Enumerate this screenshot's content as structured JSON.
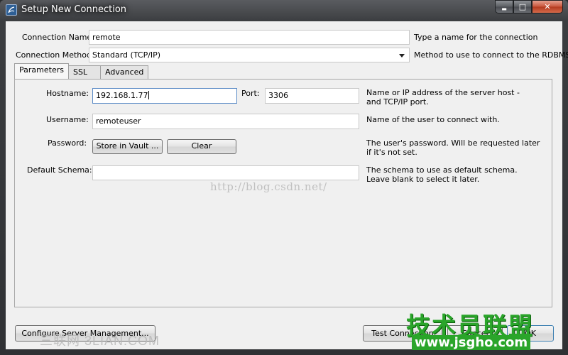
{
  "window": {
    "title": "Setup New Connection",
    "min_glyph": "▬",
    "max_glyph": "□",
    "close_glyph": "✕"
  },
  "connection_name": {
    "label": "Connection Name:",
    "value": "remote",
    "hint": "Type a name for the connection"
  },
  "connection_method": {
    "label": "Connection Method:",
    "value": "Standard (TCP/IP)",
    "hint": "Method to use to connect to the RDBMS"
  },
  "tabs": [
    {
      "label": "Parameters",
      "active": true
    },
    {
      "label": "SSL",
      "active": false
    },
    {
      "label": "Advanced",
      "active": false
    }
  ],
  "parameters": {
    "hostname": {
      "label": "Hostname:",
      "value": "192.168.1.77"
    },
    "port": {
      "label": "Port:",
      "value": "3306"
    },
    "hostname_hint": "Name or IP address of the server host - and TCP/IP port.",
    "username": {
      "label": "Username:",
      "value": "remoteuser",
      "hint": "Name of the user to connect with."
    },
    "password": {
      "label": "Password:",
      "store_button": "Store in Vault ...",
      "clear_button": "Clear",
      "hint": "The user's password. Will be requested later if it's not set."
    },
    "default_schema": {
      "label": "Default Schema:",
      "value": "",
      "hint": "The schema to use as default schema. Leave blank to select it later."
    }
  },
  "footer": {
    "configure_button": "Configure Server Management...",
    "test_button": "Test Connection",
    "cancel_button": "Cancel",
    "ok_button": "OK"
  },
  "watermarks": {
    "center_url": "http://blog.csdn.net/",
    "bottom_left": "三联网 3LIAN.COM",
    "logo_text": "技术员联盟",
    "logo_url": "www.jsgho.com"
  },
  "colors": {
    "logo_green": "#2aa52a",
    "focus_blue": "#5b8bc6"
  }
}
